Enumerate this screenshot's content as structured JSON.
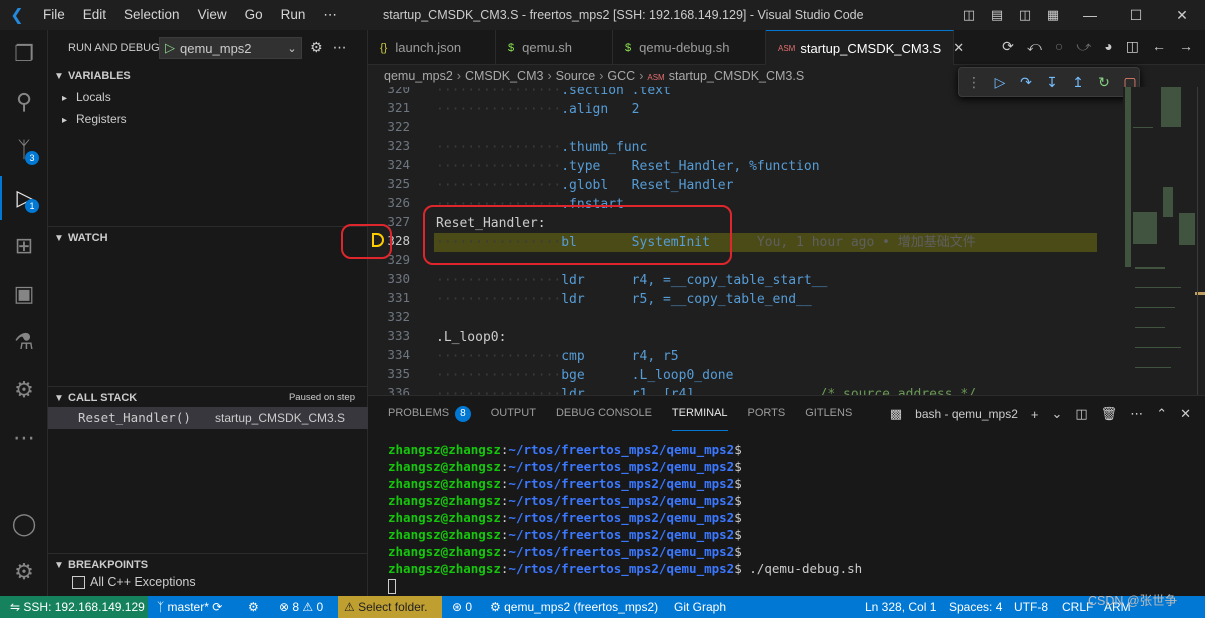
{
  "titlebar": {
    "menu": [
      "File",
      "Edit",
      "Selection",
      "View",
      "Go",
      "Run",
      "⋯"
    ],
    "title": "startup_CMSDK_CM3.S - freertos_mps2 [SSH: 192.168.149.129] - Visual Studio Code"
  },
  "activity": {
    "source_control_badge": "3",
    "debug_badge": "1"
  },
  "sidebar": {
    "title": "RUN AND DEBUG",
    "config": "qemu_mps2",
    "variables": {
      "title": "VARIABLES",
      "items": [
        "Locals",
        "Registers"
      ]
    },
    "watch": {
      "title": "WATCH"
    },
    "callstack": {
      "title": "CALL STACK",
      "status": "Paused on step",
      "frame": "Reset_Handler()",
      "file": "startup_CMSDK_CM3.S"
    },
    "breakpoints": {
      "title": "BREAKPOINTS",
      "item": "All C++ Exceptions"
    }
  },
  "tabs": [
    {
      "label": "launch.json",
      "icon": "{}"
    },
    {
      "label": "qemu.sh",
      "icon": "$"
    },
    {
      "label": "qemu-debug.sh",
      "icon": "$"
    },
    {
      "label": "startup_CMSDK_CM3.S",
      "icon": "ASM"
    }
  ],
  "breadcrumb": [
    "qemu_mps2",
    "CMSDK_CM3",
    "Source",
    "GCC",
    "startup_CMSDK_CM3.S"
  ],
  "breadcrumb_file_icon": "ASM",
  "editor": {
    "lines": [
      {
        "n": "320",
        "code": ".section .text"
      },
      {
        "n": "321",
        "code": ".align   2"
      },
      {
        "n": "322",
        "code": ""
      },
      {
        "n": "323",
        "code": ".thumb_func"
      },
      {
        "n": "324",
        "code": ".type    Reset_Handler, %function"
      },
      {
        "n": "325",
        "code": ".globl   Reset_Handler"
      },
      {
        "n": "326",
        "code": ".fnstart"
      },
      {
        "n": "327",
        "code": "Reset_Handler:"
      },
      {
        "n": "328",
        "code": "bl       SystemInit"
      },
      {
        "n": "329",
        "code": ""
      },
      {
        "n": "330",
        "code": "ldr      r4, =__copy_table_start__"
      },
      {
        "n": "331",
        "code": "ldr      r5, =__copy_table_end__"
      },
      {
        "n": "332",
        "code": ""
      },
      {
        "n": "333",
        "code": ".L_loop0:"
      },
      {
        "n": "334",
        "code": "cmp      r4, r5"
      },
      {
        "n": "335",
        "code": "bge      .L_loop0_done"
      },
      {
        "n": "336",
        "code": "ldr      r1, [r4]"
      }
    ],
    "line336_comment": "/* source address */",
    "blame": "You, 1 hour ago • 增加基础文件"
  },
  "panel": {
    "tabs": [
      "PROBLEMS",
      "OUTPUT",
      "DEBUG CONSOLE",
      "TERMINAL",
      "PORTS",
      "GITLENS"
    ],
    "problems_badge": "8",
    "active_tab": "TERMINAL",
    "shell": "bash - qemu_mps2",
    "prompt_user": "zhangsz@zhangsz",
    "prompt_path": "~/rtos/freertos_mps2/qemu_mps2",
    "command": "./qemu-debug.sh"
  },
  "status": {
    "remote": "SSH: 192.168.149.129",
    "branch": "master*",
    "errors": "8",
    "warnings": "0",
    "select_folder": "Select folder.",
    "ports": "0",
    "debug_config": "qemu_mps2 (freertos_mps2)",
    "git_graph": "Git Graph",
    "position": "Ln 328, Col 1",
    "spaces": "Spaces: 4",
    "encoding": "UTF-8",
    "eol": "CRLF",
    "language": "ARM",
    "watermark": "CSDN @张世争"
  }
}
